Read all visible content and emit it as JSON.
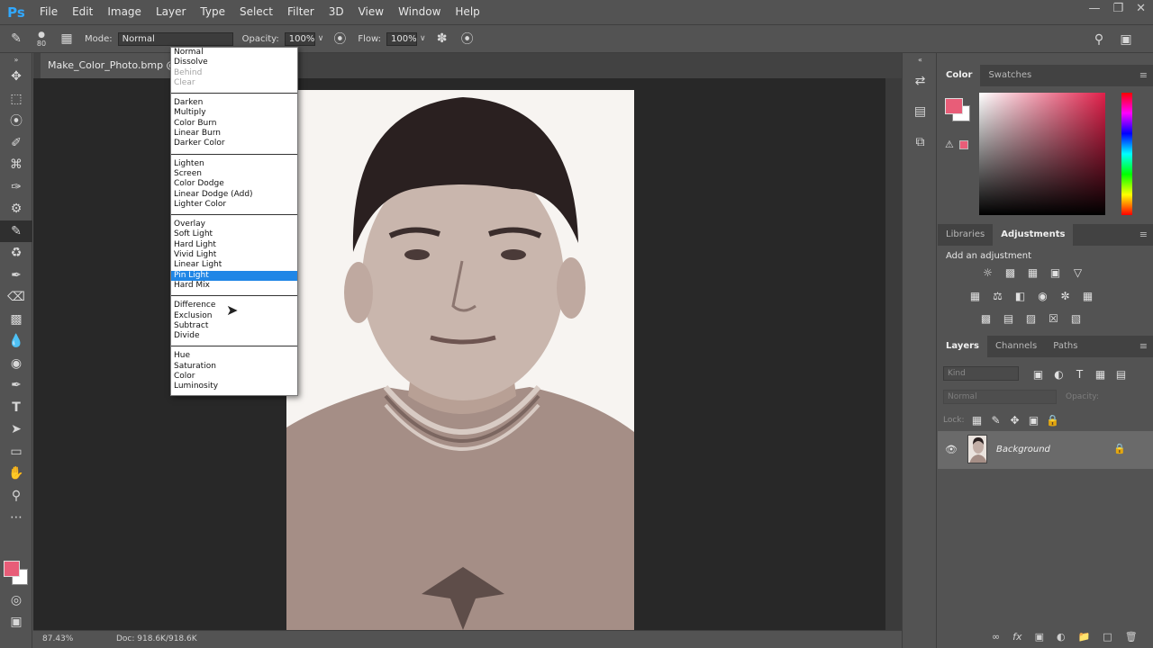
{
  "app": {
    "logo": "Ps"
  },
  "menu": [
    "File",
    "Edit",
    "Image",
    "Layer",
    "Type",
    "Select",
    "Filter",
    "3D",
    "View",
    "Window",
    "Help"
  ],
  "options": {
    "brush_size": "80",
    "mode_label": "Mode:",
    "mode_value": "Normal",
    "opacity_label": "Opacity:",
    "opacity_value": "100%",
    "flow_label": "Flow:",
    "flow_value": "100%"
  },
  "document": {
    "tab_title": "Make_Color_Photo.bmp @",
    "zoom": "87.43%",
    "doc_size": "Doc: 918.6K/918.6K"
  },
  "mode_dropdown": {
    "groups": [
      [
        {
          "label": "Normal"
        },
        {
          "label": "Dissolve"
        },
        {
          "label": "Behind",
          "disabled": true
        },
        {
          "label": "Clear",
          "disabled": true
        }
      ],
      [
        {
          "label": "Darken"
        },
        {
          "label": "Multiply"
        },
        {
          "label": "Color Burn"
        },
        {
          "label": "Linear Burn"
        },
        {
          "label": "Darker Color"
        }
      ],
      [
        {
          "label": "Lighten"
        },
        {
          "label": "Screen"
        },
        {
          "label": "Color Dodge"
        },
        {
          "label": "Linear Dodge (Add)"
        },
        {
          "label": "Lighter Color"
        }
      ],
      [
        {
          "label": "Overlay"
        },
        {
          "label": "Soft Light"
        },
        {
          "label": "Hard Light"
        },
        {
          "label": "Vivid Light"
        },
        {
          "label": "Linear Light"
        },
        {
          "label": "Pin Light",
          "selected": true
        },
        {
          "label": "Hard Mix"
        }
      ],
      [
        {
          "label": "Difference"
        },
        {
          "label": "Exclusion"
        },
        {
          "label": "Subtract"
        },
        {
          "label": "Divide"
        }
      ],
      [
        {
          "label": "Hue"
        },
        {
          "label": "Saturation"
        },
        {
          "label": "Color"
        },
        {
          "label": "Luminosity"
        }
      ]
    ]
  },
  "color_panel": {
    "tabs": [
      "Color",
      "Swatches"
    ],
    "foreground": "#e85d78",
    "background": "#ffffff"
  },
  "adjustments_panel": {
    "tabs": [
      "Libraries",
      "Adjustments"
    ],
    "title": "Add an adjustment"
  },
  "layers_panel": {
    "tabs": [
      "Layers",
      "Channels",
      "Paths"
    ],
    "filter_placeholder": "Kind",
    "blend_mode": "Normal",
    "opacity_label": "Opacity:",
    "lock_label": "Lock:",
    "layer_name": "Background"
  }
}
